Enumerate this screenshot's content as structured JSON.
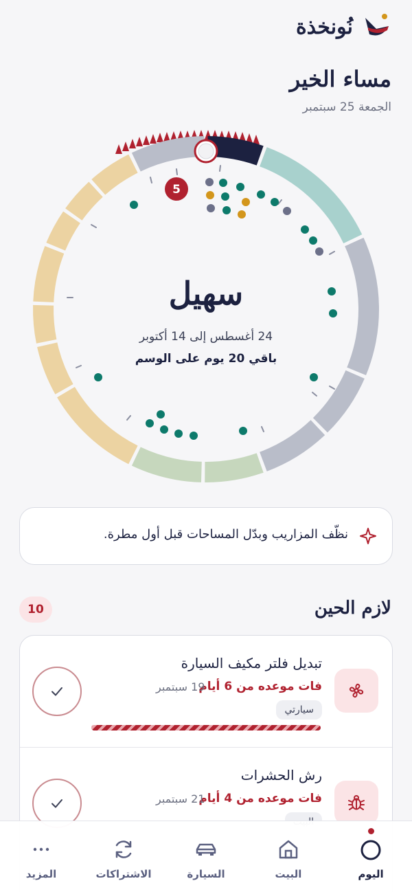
{
  "app": {
    "brand": "نُونخذة",
    "greeting": "مساء الخير",
    "date": "الجمعة 25 سبتمبر"
  },
  "season": {
    "name": "سهيل",
    "range": "24 أغسطس إلى 14 أكتوبر",
    "remaining": "باقي 20 يوم على الوسم",
    "event_count": "5",
    "current_position": 0.0
  },
  "tip": {
    "icon": "sparkle-icon",
    "text": "نظّف المزاريب وبدّل المساحات قبل أول مطرة."
  },
  "due_section": {
    "title": "لازم الحين",
    "count": "10",
    "tasks": [
      {
        "icon": "fan-icon",
        "title": "تبديل فلتر مكيف السيارة",
        "overdue": "فات موعده من 6 أيام",
        "date": "19 سبتمبر",
        "tag": "سيارتي",
        "progress": 1.0
      },
      {
        "icon": "bug-icon",
        "title": "رش الحشرات",
        "overdue": "فات موعده من 4 أيام",
        "date": "21 سبتمبر",
        "tag": "البيت"
      }
    ]
  },
  "nav": {
    "today": "اليوم",
    "home": "البيت",
    "car": "السيارة",
    "subscriptions": "الاشتراكات",
    "more": "المزيد"
  },
  "colors": {
    "navy": "#1c2140",
    "accent_red": "#b0212f",
    "season_teal": "#a8d1cd",
    "season_gray": "#b9bdc9",
    "season_sage": "#c6d7bd",
    "season_sand": "#ecd3a2",
    "dot_teal": "#0d7a6b",
    "dot_amber": "#d3961c",
    "dot_slate": "#6c7089"
  }
}
